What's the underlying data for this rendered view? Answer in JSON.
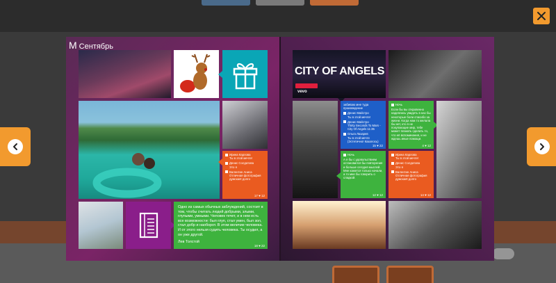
{
  "viewer": {
    "close_icon": "close-x-icon",
    "prev_icon": "chevron-left-icon",
    "next_icon": "chevron-right-icon",
    "accent_color": "#f29a2e"
  },
  "album": {
    "month_letter": "M",
    "month_label": "Сентябрь",
    "left_page": {
      "orange_comments": [
        {
          "author": "Ирина Карлова",
          "text": "Ты в этой мечте!"
        },
        {
          "author": "Денис Солдатова",
          "text": "Это я"
        },
        {
          "author": "Валентин Аниса",
          "text": "Отличная фотография думская! долго"
        }
      ],
      "orange_stats": "17 ♥ 12",
      "quote": {
        "text": "Одно из самых обычных заблуждений, состоит в том, чтобы считать людей добрыми, злыми, глупыми, умными. Человек течет, и в нем есть все возможности: был глуп, стал умен, был зол, стал добр и наоборот. В этом величие человека. И от этого нельзя судить человека. Ты осудил, а он уже другой.",
        "author": "Лев Толстой",
        "stats": "18 ♥ 22"
      }
    },
    "right_page": {
      "video_title": "CITY OF ANGELS",
      "video_brand": "vevo",
      "blue_card": {
        "lead": "забиваю мне туда произведение",
        "items": [
          {
            "author": "Денис Майстро",
            "text": "Ты в этой мечте!"
          },
          {
            "author": "Денис Майстро",
            "text": "Thirty Seconds To Mars - City Of Angels 11:35"
          },
          {
            "author": "Ольга Лазарев",
            "text": "Ты в этой мечте (Эстетично! Казалось)"
          }
        ],
        "stats": "15 ♥ 22"
      },
      "green_card_top": {
        "title": "Ночь",
        "text": "Если бы вы откровенно надеялись увидеть в нас бы некоторые боли спасибо за жизни. Когда нам то желала бы нет, кто я не покупающие мир, тебе может плакать сделать то, что её вспоминания, и не ждешь иные помощи.",
        "stats": "4 ♥ 12"
      },
      "green_card_bottom": {
        "title": "Ночь",
        "text": "А я бы с удовольствием остановился бы повторения и больше сегодня мыслей. Мне кажется только начали, а то мне бы говорить о сладкой.",
        "stats": "12 ♥ 12"
      },
      "orange_card": {
        "items": [
          {
            "author": "Ирина Карлова",
            "text": "Ты в этой мечте!"
          },
          {
            "author": "Денис Солдатова",
            "text": "Это я"
          },
          {
            "author": "Валентин Аниса",
            "text": "Отличная фотография думская! долго"
          }
        ],
        "stats": "14 ♥ 12"
      }
    }
  }
}
